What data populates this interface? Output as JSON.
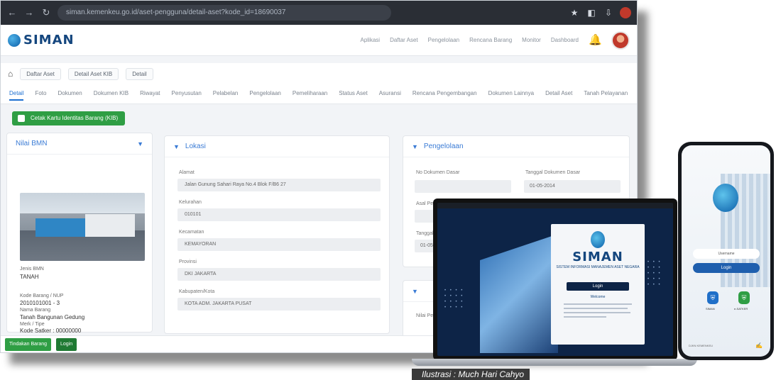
{
  "browser": {
    "url": "siman.kemenkeu.go.id/aset-pengguna/detail-aset?kode_id=18690037"
  },
  "header": {
    "logo_text": "SIMAN",
    "menu": [
      "Aplikasi",
      "Daftar Aset",
      "Pengelolaan",
      "Rencana Barang",
      "Monitor",
      "Dashboard"
    ]
  },
  "breadcrumb": [
    "Daftar Aset",
    "Detail Aset KIB",
    "Detail"
  ],
  "tabs": [
    "Detail",
    "Foto",
    "Dokumen",
    "Dokumen KIB",
    "Riwayat",
    "Penyusutan",
    "Pelabelan",
    "Pengelolaan",
    "Pemeliharaan",
    "Status Aset",
    "Asuransi",
    "Rencana Pengembangan",
    "Dokumen Lainnya",
    "Detail Aset",
    "Tanah Pelayanan"
  ],
  "actions": {
    "print_kib": "Cetak Kartu Identitas Barang (KIB)",
    "tindakan": "Tindakan Barang",
    "login": "Login"
  },
  "side_card": {
    "title": "Nilai BMN",
    "jenis_label": "Jenis BMN",
    "jenis_value": "TANAH",
    "kode_label": "Kode Barang / NUP",
    "kode_value": "2010101001 - 3",
    "nama_label": "Nama Barang",
    "nama_value": "Tanah Bangunan Gedung",
    "merk_label": "Merk / Tipe",
    "merk_value": "Kode Satker : 00000000"
  },
  "lokasi": {
    "title": "Lokasi",
    "fields": [
      {
        "label": "Alamat",
        "value": "Jalan Gunung Sahari Raya No.4 Blok F/B6 27"
      },
      {
        "label": "Kelurahan",
        "value": "010101"
      },
      {
        "label": "Kecamatan",
        "value": "KEMAYORAN"
      },
      {
        "label": "Provinsi",
        "value": "DKI JAKARTA"
      },
      {
        "label": "Kabupaten/Kota",
        "value": "KOTA ADM. JAKARTA PUSAT"
      }
    ]
  },
  "pengelolaan": {
    "title": "Pengelolaan",
    "no_label": "No Dokumen Dasar",
    "tanggal_label": "Tanggal Dokumen Dasar",
    "tanggal_value": "01-05-2014",
    "f3_label": "Asal Perolehan",
    "f4_label": "Tanggal Perolehan",
    "f4_value": "01-05-2014",
    "bottom_label": "Nilai Perolehan"
  },
  "laptop": {
    "logo_text": "SIMAN",
    "subtitle": "SISTEM INFORMASI MANAJEMEN ASET NEGARA",
    "login": "Login",
    "notice": "Welcome"
  },
  "phone": {
    "input_placeholder": "Username",
    "login": "Login",
    "icon_a_label": "SIMAN",
    "icon_b_label": "e-SATKER",
    "footer": "DJKN KEMENKEU"
  },
  "caption": "Ilustrasi : Much Hari Cahyo"
}
